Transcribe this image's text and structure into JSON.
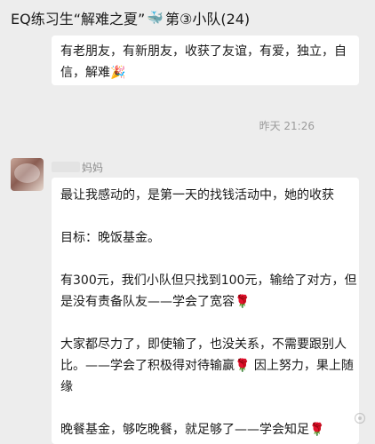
{
  "header": {
    "title_prefix": "EQ练习生“解难之夏”",
    "whale_icon": "🐳",
    "title_suffix": "第③小队(24)"
  },
  "messages": [
    {
      "lines": [
        "有老朋友，有新朋友，收获了友谊，有爱，独立，自",
        "信，解难"
      ],
      "party_icon": "🎉"
    },
    {
      "sender_suffix": "妈妈",
      "paragraphs": {
        "p1": "最让我感动的，是第一天的找钱活动中，她的收获",
        "p2": "目标：晚饭基金。",
        "p3_l1": "有300元，我们小队但只找到100元，输给了对方，但",
        "p3_l2": "是没有责备队友——学会了宽容",
        "p4_l1": "大家都尽力了，即使输了，也没关系，不需要跟别人",
        "p4_l2a": "比。——学会了积极得对待输赢",
        "p4_l2b": "因上努力，果上随",
        "p4_l3": "缘",
        "p5": "晚餐基金，够吃晚餐，就足够了——学会知足"
      },
      "rose_icon": "🌹"
    }
  ],
  "time_divider": "昨天 21:26"
}
